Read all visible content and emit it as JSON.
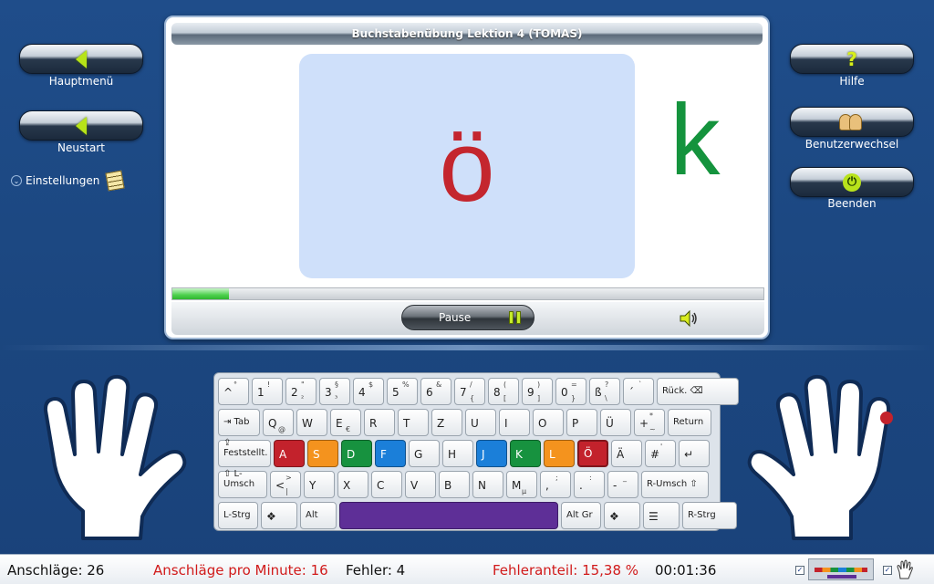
{
  "title": "Buchstabenübung Lektion 4 (TOMAS)",
  "left_buttons": [
    {
      "label": "Hauptmenü",
      "icon": "arrow-left-icon"
    },
    {
      "label": "Neustart",
      "icon": "arrow-left-icon"
    }
  ],
  "settings_label": "Einstellungen",
  "right_buttons": [
    {
      "label": "Hilfe",
      "icon": "help-icon"
    },
    {
      "label": "Benutzerwechsel",
      "icon": "users-icon"
    },
    {
      "label": "Beenden",
      "icon": "power-icon"
    }
  ],
  "exercise": {
    "current_letter": "ö",
    "next_letter": "k",
    "progress": 0.095,
    "pause_label": "Pause"
  },
  "colors": {
    "current_letter": "#c4262e",
    "next_letter": "#14933d",
    "finger_red": "#c3222c",
    "finger_orange": "#f4931e",
    "finger_green": "#17923f",
    "finger_blue": "#1b7fd9",
    "space": "#5e2f97"
  },
  "keyboard": {
    "row1": [
      {
        "m": "^",
        "s": "°"
      },
      {
        "m": "1",
        "s": "!"
      },
      {
        "m": "2",
        "s": "\"",
        "a": "²"
      },
      {
        "m": "3",
        "s": "§",
        "a": "³"
      },
      {
        "m": "4",
        "s": "$"
      },
      {
        "m": "5",
        "s": "%"
      },
      {
        "m": "6",
        "s": "&"
      },
      {
        "m": "7",
        "s": "/",
        "a": "{"
      },
      {
        "m": "8",
        "s": "(",
        "a": "["
      },
      {
        "m": "9",
        "s": ")",
        "a": "]"
      },
      {
        "m": "0",
        "s": "=",
        "a": "}"
      },
      {
        "m": "ß",
        "s": "?",
        "a": "\\"
      },
      {
        "m": "´",
        "s": "`"
      },
      {
        "m": "Rück. ⌫"
      }
    ],
    "row2": [
      {
        "m": "⇥ Tab"
      },
      {
        "m": "Q",
        "a": "@"
      },
      {
        "m": "W"
      },
      {
        "m": "E",
        "a": "€"
      },
      {
        "m": "R"
      },
      {
        "m": "T"
      },
      {
        "m": "Z"
      },
      {
        "m": "U"
      },
      {
        "m": "I"
      },
      {
        "m": "O"
      },
      {
        "m": "P"
      },
      {
        "m": "Ü"
      },
      {
        "m": "+",
        "s": "*",
        "a": "~"
      },
      {
        "m": "Return"
      }
    ],
    "row3": [
      {
        "m": "⇪ Feststellt."
      },
      {
        "m": "A"
      },
      {
        "m": "S"
      },
      {
        "m": "D"
      },
      {
        "m": "F"
      },
      {
        "m": "G"
      },
      {
        "m": "H"
      },
      {
        "m": "J"
      },
      {
        "m": "K"
      },
      {
        "m": "L"
      },
      {
        "m": "Ö"
      },
      {
        "m": "Ä"
      },
      {
        "m": "#",
        "s": "'"
      },
      {
        "m": "↵"
      }
    ],
    "row4": [
      {
        "m": "⇧ L-Umsch"
      },
      {
        "m": "<",
        "s": ">",
        "a": "|"
      },
      {
        "m": "Y"
      },
      {
        "m": "X"
      },
      {
        "m": "C"
      },
      {
        "m": "V"
      },
      {
        "m": "B"
      },
      {
        "m": "N"
      },
      {
        "m": "M",
        "a": "µ"
      },
      {
        "m": ",",
        "s": ";"
      },
      {
        "m": ".",
        "s": ":"
      },
      {
        "m": "-",
        "s": "_"
      },
      {
        "m": "R-Umsch ⇧"
      }
    ],
    "row5": [
      {
        "m": "L-Strg"
      },
      {
        "m": "❖"
      },
      {
        "m": "Alt"
      },
      {
        "m": ""
      },
      {
        "m": "Alt Gr"
      },
      {
        "m": "❖"
      },
      {
        "m": "☰"
      },
      {
        "m": "R-Strg"
      }
    ]
  },
  "status": {
    "strokes": "Anschläge: 26",
    "strokes_per_min": "Anschläge pro Minute: 16",
    "errors": "Fehler: 4",
    "error_rate": "Fehleranteil: 15,38 %",
    "time": "00:01:36"
  }
}
